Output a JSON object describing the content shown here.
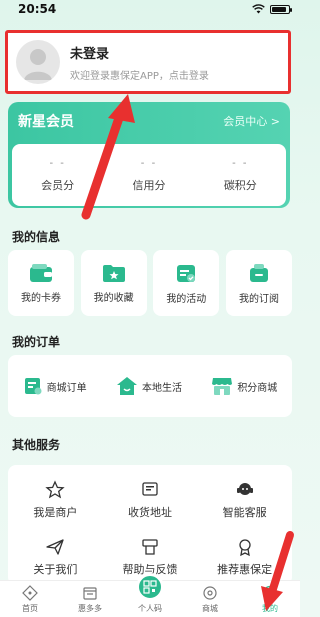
{
  "status_bar": {
    "time": "20:54"
  },
  "login": {
    "title": "未登录",
    "subtitle": "欢迎登录惠保定APP，点击登录"
  },
  "member": {
    "title": "新星会员",
    "center_link": "会员中心 >",
    "stats": [
      {
        "value": "- -",
        "label": "会员分"
      },
      {
        "value": "- -",
        "label": "信用分"
      },
      {
        "value": "- -",
        "label": "碳积分"
      }
    ]
  },
  "my_info": {
    "title": "我的信息",
    "items": [
      {
        "label": "我的卡券",
        "icon": "wallet-icon"
      },
      {
        "label": "我的收藏",
        "icon": "folder-star-icon"
      },
      {
        "label": "我的活动",
        "icon": "calendar-check-icon"
      },
      {
        "label": "我的订阅",
        "icon": "subscribe-box-icon"
      }
    ]
  },
  "my_orders": {
    "title": "我的订单",
    "items": [
      {
        "label": "商城订单",
        "icon": "order-list-icon"
      },
      {
        "label": "本地生活",
        "icon": "house-icon"
      },
      {
        "label": "积分商城",
        "icon": "store-icon"
      }
    ]
  },
  "other_services": {
    "title": "其他服务",
    "items": [
      {
        "label": "我是商户",
        "icon": "star-icon"
      },
      {
        "label": "收货地址",
        "icon": "address-card-icon"
      },
      {
        "label": "智能客服",
        "icon": "headset-icon"
      },
      {
        "label": "关于我们",
        "icon": "paper-plane-icon"
      },
      {
        "label": "帮助与反馈",
        "icon": "printer-icon"
      },
      {
        "label": "推荐惠保定",
        "icon": "medal-icon"
      }
    ]
  },
  "tabbar": {
    "items": [
      {
        "label": "首页",
        "icon": "home-icon"
      },
      {
        "label": "惠多多",
        "icon": "shop-icon"
      },
      {
        "label": "个人码",
        "icon": "qr-code-icon"
      },
      {
        "label": "商城",
        "icon": "mall-icon"
      },
      {
        "label": "我的",
        "icon": "profile-icon",
        "active": true
      }
    ]
  },
  "colors": {
    "accent": "#2bb98e",
    "highlight": "#e8302f"
  }
}
